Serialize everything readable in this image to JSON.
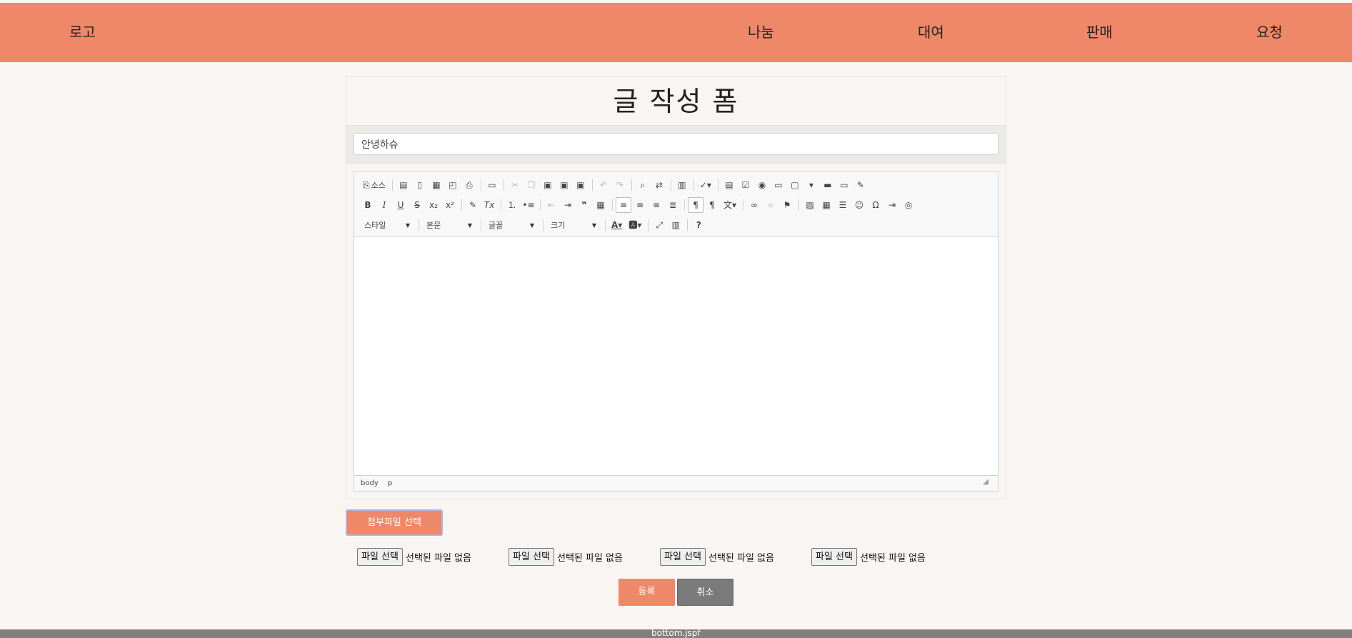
{
  "header": {
    "logo": "로고",
    "nav": [
      "나눔",
      "대여",
      "판매",
      "요청"
    ],
    "bg_color": "#ef8868"
  },
  "form": {
    "title": "글 작성 폼",
    "subject_value": "안녕하슈"
  },
  "editor": {
    "source_label": "소스",
    "combos": {
      "style": "스타일",
      "format": "본문",
      "font": "글꼴",
      "size": "크기"
    },
    "status_path": [
      "body",
      "p"
    ]
  },
  "attachments": {
    "button_label": "첨부파일 선택",
    "pick_label": "파일 선택",
    "none_label": "선택된 파일 없음"
  },
  "actions": {
    "submit": "등록",
    "cancel": "취소"
  },
  "footer": {
    "text": "bottom.jspf"
  },
  "colors": {
    "accent": "#ef8868",
    "cancel": "#7a7a7a",
    "background": "#f8f5f2"
  }
}
